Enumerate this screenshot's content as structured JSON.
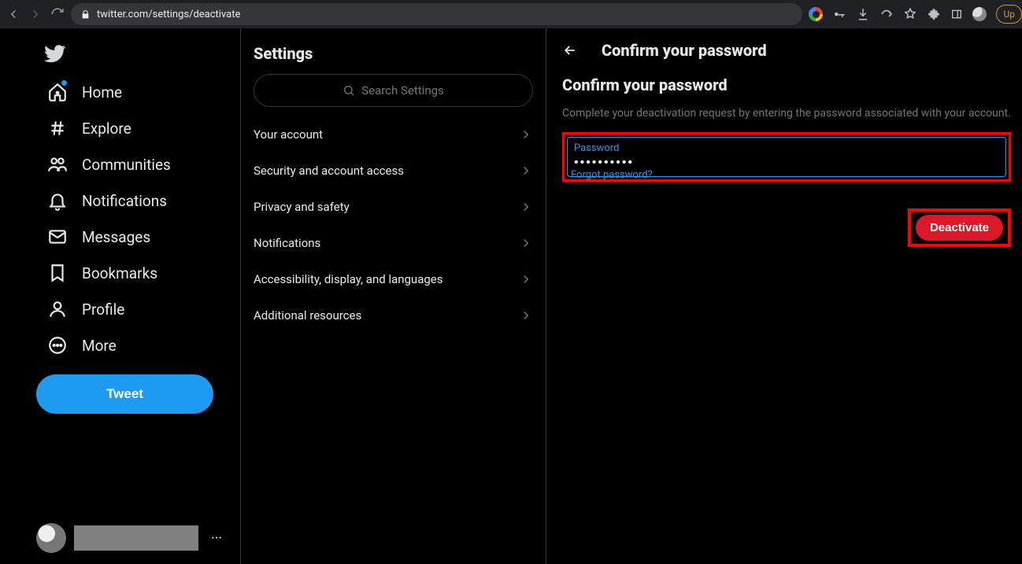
{
  "browser": {
    "url": "twitter.com/settings/deactivate",
    "update_label": "Up"
  },
  "nav": {
    "items": [
      {
        "label": "Home"
      },
      {
        "label": "Explore"
      },
      {
        "label": "Communities"
      },
      {
        "label": "Notifications"
      },
      {
        "label": "Messages"
      },
      {
        "label": "Bookmarks"
      },
      {
        "label": "Profile"
      },
      {
        "label": "More"
      }
    ],
    "tweet_label": "Tweet"
  },
  "settings": {
    "title": "Settings",
    "search_placeholder": "Search Settings",
    "items": [
      {
        "label": "Your account"
      },
      {
        "label": "Security and account access"
      },
      {
        "label": "Privacy and safety"
      },
      {
        "label": "Notifications"
      },
      {
        "label": "Accessibility, display, and languages"
      },
      {
        "label": "Additional resources"
      }
    ]
  },
  "detail": {
    "header_title": "Confirm your password",
    "sub_title": "Confirm your password",
    "help_text": "Complete your deactivation request by entering the password associated with your account.",
    "password_label": "Password",
    "password_value": "••••••••••",
    "forgot_label": "Forgot password?",
    "deactivate_label": "Deactivate"
  }
}
